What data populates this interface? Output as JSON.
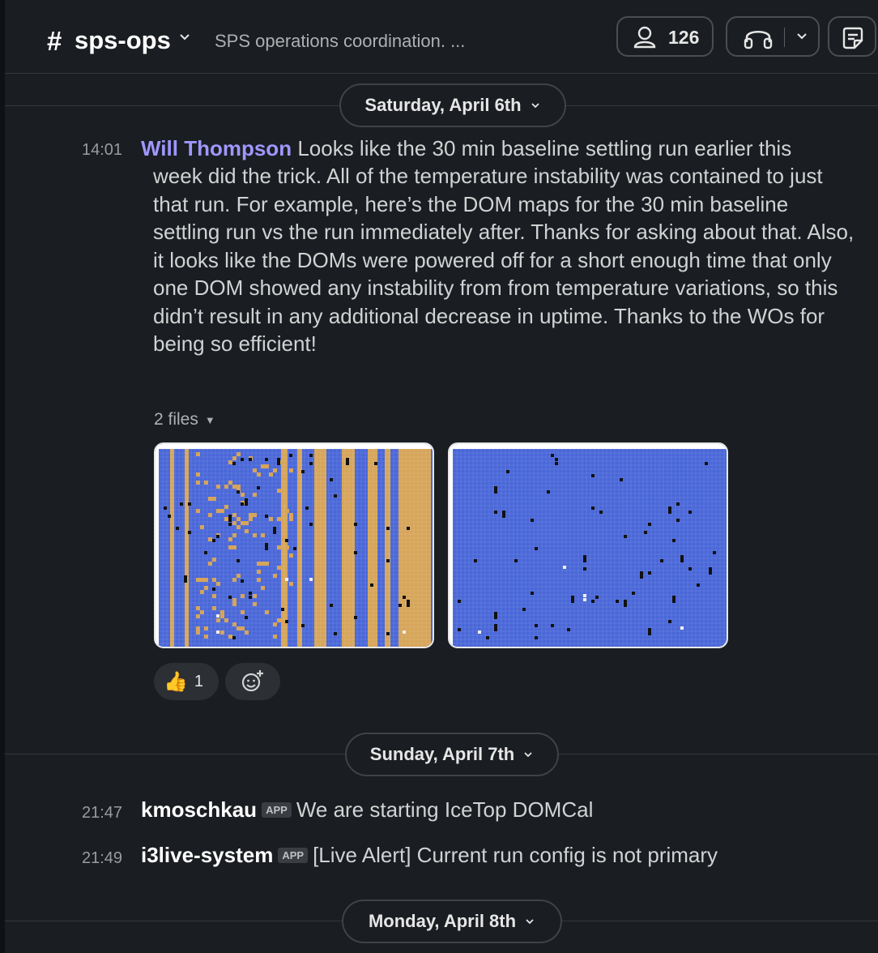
{
  "channel": {
    "hash": "#",
    "name": "sps-ops",
    "description": "SPS operations coordination. ...",
    "member_count": "126"
  },
  "colors": {
    "background": "#1a1d21",
    "author": "#9f97ff",
    "text": "#d1d2d3",
    "dom_blue": "#4a67d8",
    "dom_orange": "#d6a55a"
  },
  "icons": {
    "members": "person-icon",
    "huddle": "headphones-icon",
    "huddle_menu": "chevron-down-icon",
    "canvas": "canvas-icon",
    "add_reaction": "add-reaction-icon"
  },
  "dates": {
    "d1": "Saturday, April 6th",
    "d2": "Sunday, April 7th",
    "d3": "Monday, April 8th"
  },
  "message1": {
    "time": "14:01",
    "author": "Will Thompson",
    "first_line": "Looks like the 30 min baseline settling run earlier this",
    "body": "week did the trick. All of the temperature instability was contained to just that run. For example, here’s the DOM maps for the 30 min baseline settling run vs the run immediately after. Thanks for asking about that. Also, it looks like the DOMs were powered off for a short enough time that only one DOM showed any instability from from temperature variations, so this didn’t result in any additional decrease in uptime. Thanks to the WOs for being so efficient!",
    "files_label": "2 files",
    "reaction_emoji": "👍",
    "reaction_count": "1"
  },
  "message2": {
    "time": "21:47",
    "author": "kmoschkau",
    "badge": "APP",
    "text": "We are starting IceTop DOMCal"
  },
  "message3": {
    "time": "21:49",
    "author": "i3live-system",
    "badge": "APP",
    "text": "[Live Alert] Current run config is not primary"
  }
}
